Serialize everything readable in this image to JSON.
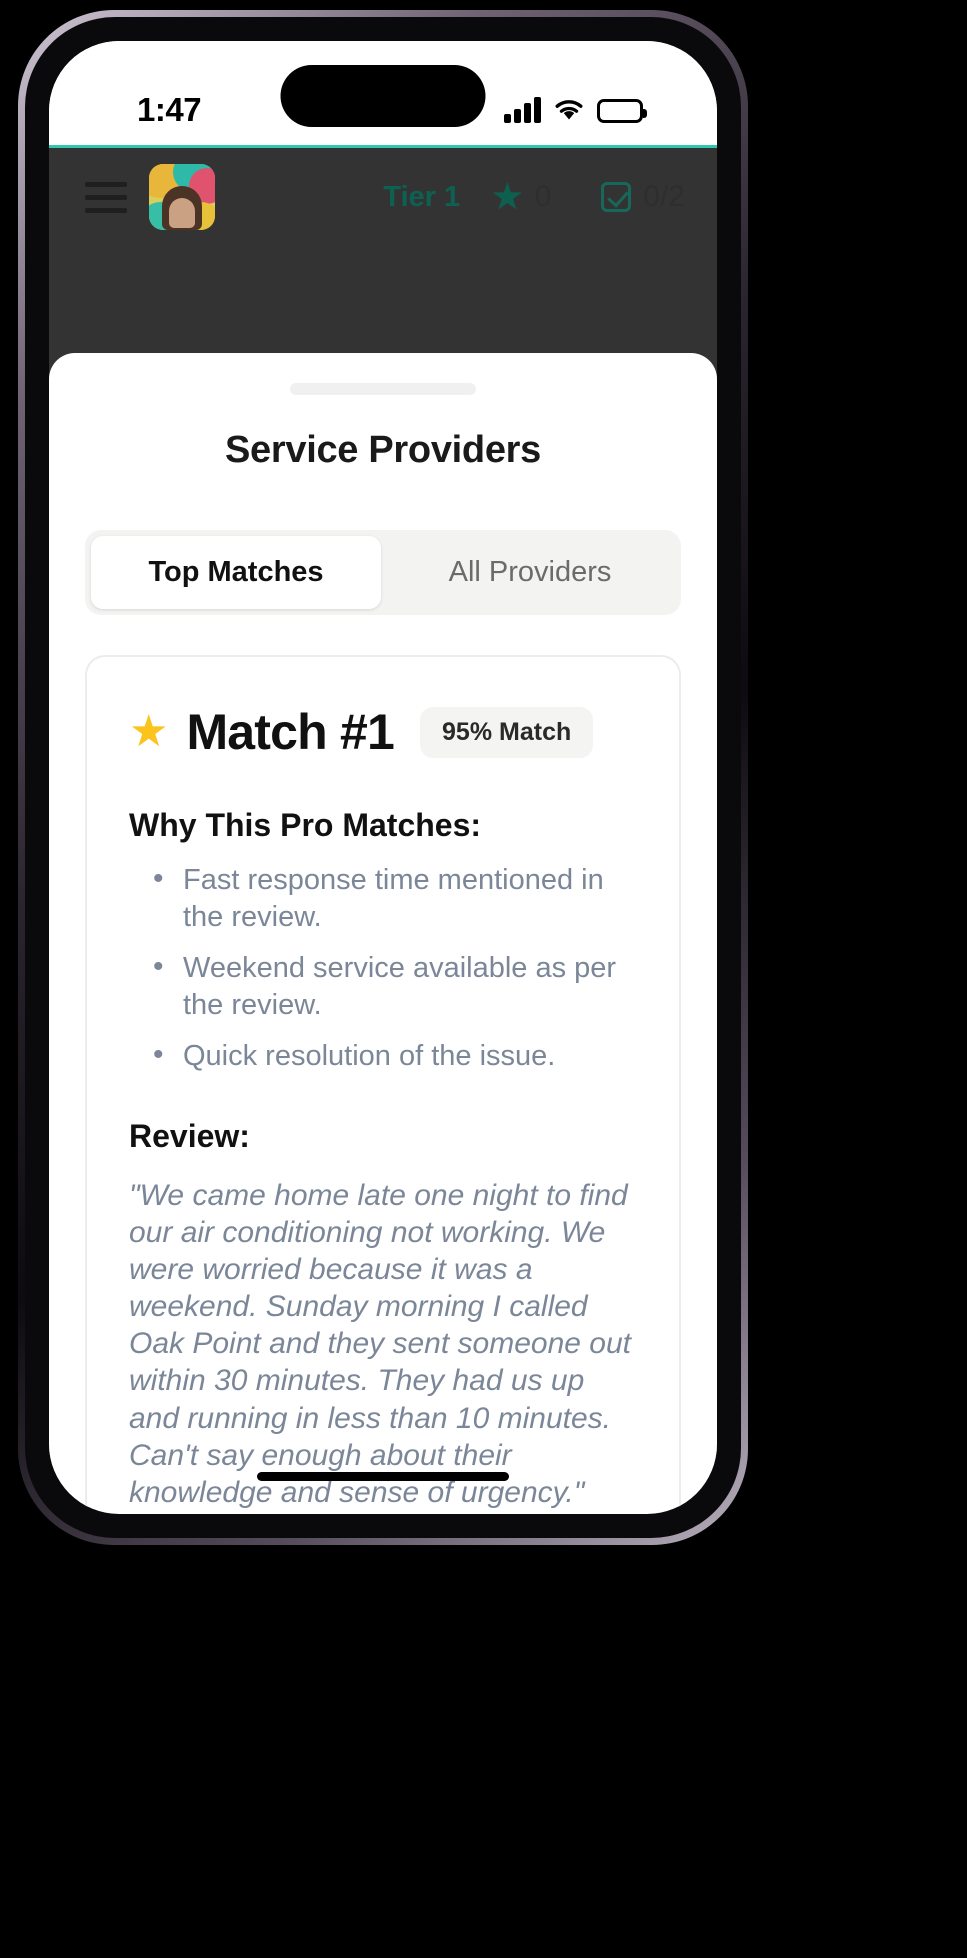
{
  "status_bar": {
    "time": "1:47",
    "icons": [
      "cellular-signal-icon",
      "wifi-icon",
      "battery-icon"
    ]
  },
  "app_header": {
    "menu_icon": "hamburger-menu-icon",
    "avatar": "user-avatar",
    "tier_label": "Tier 1",
    "star_icon": "star-icon",
    "star_count": "0",
    "task_icon": "checkbox-icon",
    "task_count": "0/2"
  },
  "sheet": {
    "grabber": "drag-handle",
    "title": "Service Providers",
    "tabs": [
      {
        "label": "Top Matches",
        "active": true
      },
      {
        "label": "All Providers",
        "active": false
      }
    ]
  },
  "match_card": {
    "star_icon": "star-icon",
    "title": "Match #1",
    "badge": "95% Match",
    "reasons_heading": "Why This Pro Matches:",
    "reasons": [
      "Fast response time mentioned in the review.",
      "Weekend service available as per the review.",
      "Quick resolution of the issue."
    ],
    "review_heading": "Review:",
    "review_text": "\"We came home late one night to find our air conditioning not working. We were worried because it was a weekend. Sunday morning I called Oak Point and they sent someone out within 30 minutes. They had us up and running in less than 10 minutes. Can't say enough about their knowledge and sense of urgency.\""
  },
  "colors": {
    "accent_teal": "#2fc7b0",
    "tier_green": "#0d6152",
    "star_yellow": "#fbc31c",
    "body_text": "#7b8798",
    "overlay": "#333333"
  }
}
